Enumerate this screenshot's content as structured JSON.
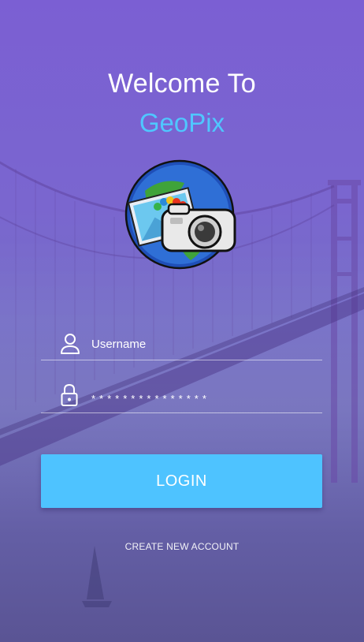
{
  "header": {
    "welcome_text": "Welcome To",
    "app_name": "GeoPix"
  },
  "logo": {
    "icon": "globe-camera-photo-logo"
  },
  "form": {
    "username_placeholder": "Username",
    "username_icon": "user-icon",
    "password_value": "***************",
    "password_icon": "lock-icon",
    "login_label": "LOGIN"
  },
  "footer": {
    "create_account_label": "CREATE NEW ACCOUNT"
  },
  "colors": {
    "background_top": "#7b5fd3",
    "background_bottom": "#5a5494",
    "brand_accent": "#4fc7ff",
    "login_button": "#4ec3ff",
    "text": "#ffffff"
  }
}
